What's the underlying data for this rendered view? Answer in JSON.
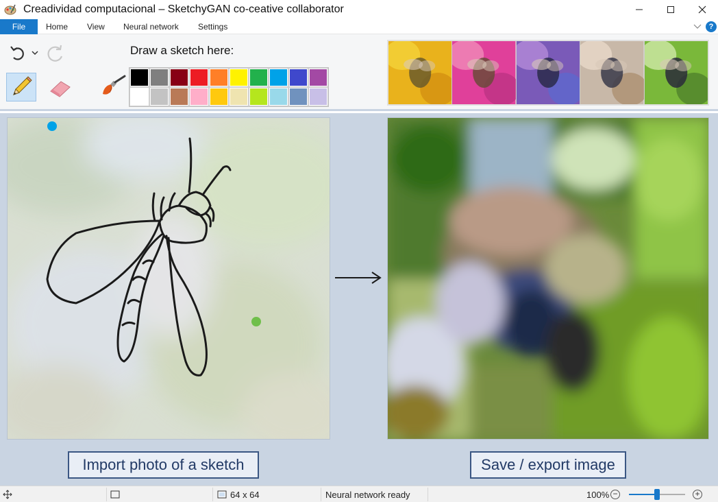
{
  "window": {
    "title": "Creadividad computacional – SketchyGAN co-ceative collaborator",
    "minimize_icon": "minimize-icon",
    "maximize_icon": "maximize-icon",
    "close_icon": "close-icon"
  },
  "menu": {
    "items": [
      "File",
      "Home",
      "View",
      "Neural network",
      "Settings"
    ],
    "active": "File"
  },
  "toolbar": {
    "draw_label": "Draw a sketch here:",
    "palette": [
      "#000000",
      "#7f7f7f",
      "#880015",
      "#ed1c24",
      "#ff7f27",
      "#fff200",
      "#22b14c",
      "#00a2e8",
      "#3f48cc",
      "#a349a4",
      "#ffffff",
      "#c3c3c3",
      "#b97a57",
      "#ffaec9",
      "#ffc90e",
      "#efe4b0",
      "#b5e61d",
      "#99d9ea",
      "#7092be",
      "#c8bfe7"
    ],
    "thumbnail_count": 5
  },
  "main": {
    "import_button": "Import photo of a sketch",
    "save_button": "Save / export image"
  },
  "status": {
    "canvas_size": "64 x 64",
    "network_status": "Neural network ready",
    "zoom": "100%",
    "zoom_level": 0.5
  },
  "colors": {
    "accent": "#1979ca",
    "main_bg": "#c9d4e2",
    "button_border": "#3a5683"
  }
}
